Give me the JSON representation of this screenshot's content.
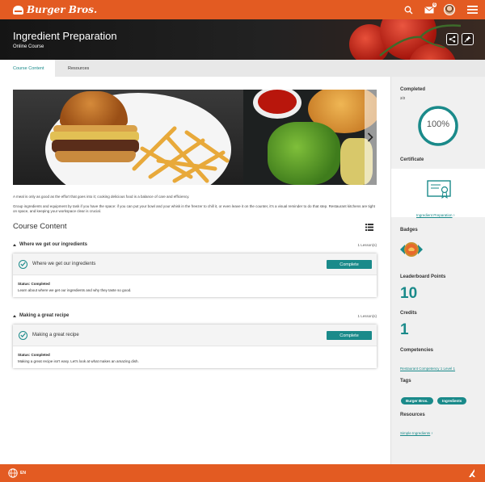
{
  "brand": {
    "name": "Burger Bros."
  },
  "header": {
    "mail_count": "6"
  },
  "course": {
    "title": "Ingredient Preparation",
    "type": "Online Course"
  },
  "tabs": [
    {
      "label": "Course Content"
    },
    {
      "label": "Resources"
    }
  ],
  "description": {
    "p1": "A meal is only as good as the effort that goes into it; cooking delicious food is a balance of care and efficiency.",
    "p2": "Group ingredients and equipment by task if you have the space: if you can put your bowl and your whisk in the freezer to chill it, or even leave it on the counter, it's a visual reminder to do that step. Restaurant kitchens are tight on space, and keeping your workspace clear is crucial."
  },
  "content": {
    "title": "Course Content",
    "sections": [
      {
        "title": "Where we get our ingredients",
        "count": "1 Lesson(s)",
        "lesson": {
          "name": "Where we get our ingredients",
          "button": "Complete",
          "status": "Status: Completed",
          "summary": "Learn about where we get our ingredients and why they taste so good."
        }
      },
      {
        "title": "Making a great recipe",
        "count": "1 Lesson(s)",
        "lesson": {
          "name": "Making a great recipe",
          "button": "Complete",
          "status": "Status: Completed",
          "summary": "Making a great recipe isn't easy. Let's look at what makes an amazing dish."
        }
      }
    ]
  },
  "sidebar": {
    "completed": {
      "label": "Completed",
      "fraction": "2/2",
      "percent": "100%",
      "progress": 1.0
    },
    "certificate": {
      "label": "Certificate",
      "link": "Ingredient Preparation"
    },
    "badges": {
      "label": "Badges"
    },
    "leaderboard": {
      "label": "Leaderboard Points",
      "value": "10"
    },
    "credits": {
      "label": "Credits",
      "value": "1"
    },
    "competencies": {
      "label": "Competencies",
      "link": "Restaurant Competency 1 Level 1"
    },
    "tags": {
      "label": "Tags",
      "items": [
        "Burger Bros.",
        "Ingredients"
      ]
    },
    "resources": {
      "label": "Resources",
      "link": "Simple Ingredients"
    }
  },
  "footer": {
    "language": "EN"
  },
  "colors": {
    "brand": "#e35b22",
    "accent": "#1a8a8a"
  }
}
